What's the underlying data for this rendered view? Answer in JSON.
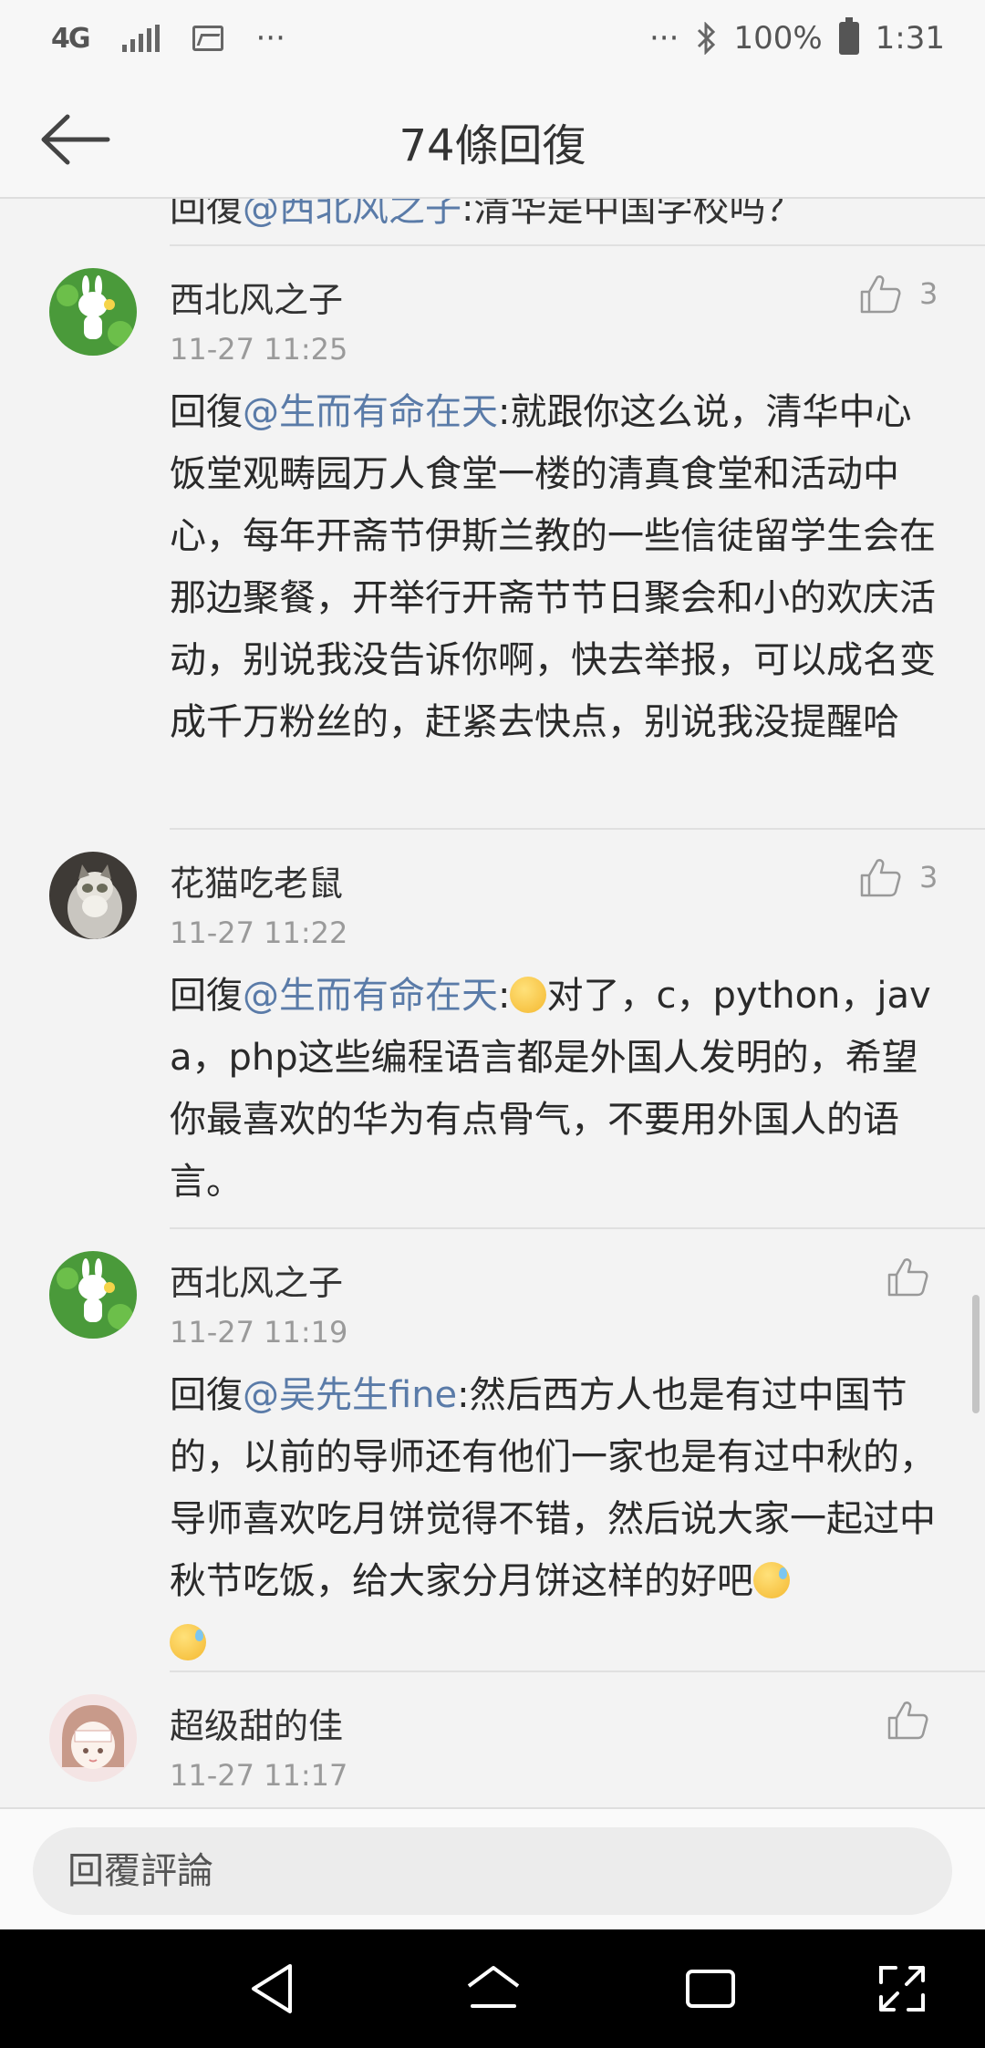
{
  "status_bar": {
    "network": "4G",
    "more": "···",
    "more_right": "···",
    "battery": "100%",
    "time": "1:31"
  },
  "header": {
    "title": "74條回復"
  },
  "partial_top": {
    "prefix": "回復",
    "mention": "@西北风之子",
    "text": ":清华是中国学校吗？"
  },
  "comments": [
    {
      "user": "西北风之子",
      "time": "11-27 11:25",
      "likes": "3",
      "reply_prefix": "回復",
      "mention": "@生而有命在天",
      "text": ":就跟你这么说，清华中心饭堂观畴园万人食堂一楼的清真食堂和活动中心，每年开斋节伊斯兰教的一些信徒留学生会在那边聚餐，开举行开斋节节日聚会和小的欢庆活动，别说我没告诉你啊，快去举报，可以成名变成千万粉丝的，赶紧去快点，别说我没提醒哈"
    },
    {
      "user": "花猫吃老鼠",
      "time": "11-27 11:22",
      "likes": "3",
      "reply_prefix": "回復",
      "mention": "@生而有命在天",
      "text_after_emoji": "对了，c，python，java，php这些编程语言都是外国人发明的，希望你最喜欢的华为有点骨气，不要用外国人的语言。"
    },
    {
      "user": "西北风之子",
      "time": "11-27 11:19",
      "likes": "",
      "reply_prefix": "回復",
      "mention": "@吴先生fine",
      "text": ":然后西方人也是有过中国节的，以前的导师还有他们一家也是有过中秋的，导师喜欢吃月饼觉得不错，然后说大家一起过中秋节吃饭，给大家分月饼这样的好吧"
    },
    {
      "user": "超级甜的佳",
      "time": "11-27 11:17",
      "likes": ""
    }
  ],
  "reply_box": {
    "placeholder": "回覆評論"
  },
  "icons": {
    "back": "back-arrow-icon",
    "like": "thumbs-up-icon",
    "nav_back": "triangle-back-icon",
    "nav_home": "home-icon",
    "nav_recents": "recents-icon",
    "nav_expand": "expand-icon"
  },
  "colors": {
    "mention": "#5a7ba8",
    "background": "#f3f3f3",
    "nav_bar": "#000000"
  }
}
